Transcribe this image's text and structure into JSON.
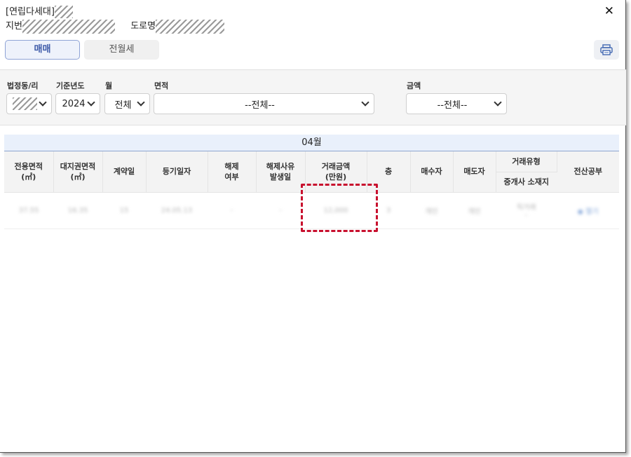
{
  "header": {
    "title": "[연립다세대]",
    "jibun_label": "지번",
    "road_label": "도로명",
    "close_label": "✕"
  },
  "tabs": [
    {
      "label": "매매",
      "active": true
    },
    {
      "label": "전월세",
      "active": false
    }
  ],
  "print_icon": "printer-icon",
  "filters": {
    "dong": {
      "label": "법정동/리",
      "value": ""
    },
    "year": {
      "label": "기준년도",
      "value": "2024"
    },
    "month": {
      "label": "월",
      "value": "전체"
    },
    "area": {
      "label": "면적",
      "value": "--전체--"
    },
    "amount": {
      "label": "금액",
      "value": "--전체--"
    }
  },
  "grid": {
    "month_title": "04월",
    "headers": {
      "area": "전용면적\n(㎡)",
      "land": "대지권면적\n(㎡)",
      "contract_day": "계약일",
      "reg_date": "등기일자",
      "cancel": "해제\n여부",
      "cancel_date": "해제사유\n발생일",
      "price": "거래금액\n(만원)",
      "floor": "층",
      "buyer": "매수자",
      "seller": "매도자",
      "deal_type": "거래유형",
      "broker": "중개사 소재지",
      "registry": "전산공부"
    },
    "row": {
      "area": "37.55",
      "land": "16.35",
      "contract_day": "15",
      "reg_date": "24.05.13",
      "cancel": "-",
      "cancel_date": "-",
      "price": "12,000",
      "floor": "3",
      "buyer": "개인",
      "seller": "개인",
      "deal_type": "직거래",
      "broker": "-",
      "registry": "열기"
    }
  },
  "colors": {
    "accent": "#3d5aa8",
    "highlight": "#c8102e",
    "month_bar": "#e9f0fb"
  }
}
